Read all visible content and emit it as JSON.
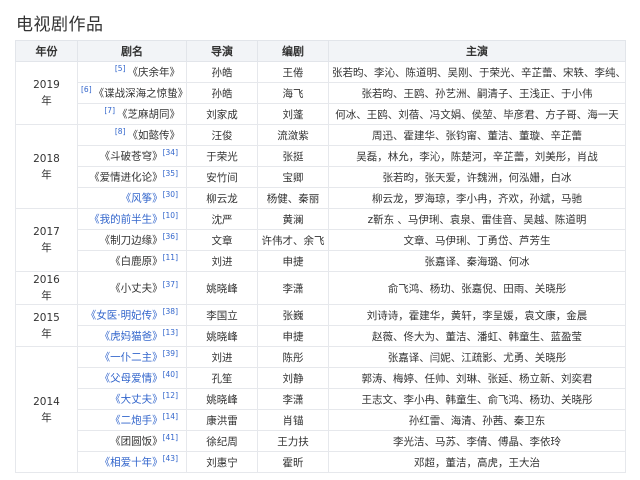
{
  "page": {
    "heading": "电视剧作品"
  },
  "table": {
    "headers": {
      "year": "年份",
      "drama": "剧名",
      "director": "导演",
      "writer": "编剧",
      "cast": "主演"
    },
    "groups": [
      {
        "year_top": "2019",
        "year_bottom": "年",
        "rows": [
          {
            "ref": "[5]",
            "title": "《庆余年》",
            "link": false,
            "director": "孙皓",
            "writer": "王倦",
            "cast": "张若昀、李沁、陈道明、吴刚、于荣光、辛芷蕾、宋轶、李纯、肖战"
          },
          {
            "ref": "[6]",
            "title": "《谍战深海之惊蛰》",
            "link": false,
            "director": "孙皓",
            "writer": "海飞",
            "cast": "张若昀、王鸥、孙艺洲、嗣清子、王浅正、于小伟"
          },
          {
            "ref": "[7]",
            "title": "《芝麻胡同》",
            "link": false,
            "director": "刘家成",
            "writer": "刘蓬",
            "cast": "何冰、王鸥、刘蓓、冯文娟、侯堃、毕彦君、方子哥、海一天"
          }
        ]
      },
      {
        "year_top": "2018",
        "year_bottom": "年",
        "rows": [
          {
            "ref": "[8]",
            "title": "《如懿传》",
            "link": false,
            "director": "汪俊",
            "writer": "流潋紫",
            "cast": "周迅、霍建华、张钧甯、董洁、董璇、辛芷蕾"
          },
          {
            "ref": "",
            "title": "《斗破苍穹》",
            "sup": "[34]",
            "link": false,
            "director": "于荣光",
            "writer": "张挺",
            "cast": "吴磊，林允，李沁，陈楚河，辛芷蕾，刘美彤，肖战"
          },
          {
            "ref": "",
            "title": "《爱情进化论》",
            "sup": "[35]",
            "link": false,
            "director": "安竹间",
            "writer": "宝卿",
            "cast": "张若昀，张天爱，许魏洲，何泓姗，白冰"
          },
          {
            "ref": "",
            "title": "《风筝》",
            "sup": "[30]",
            "link": true,
            "director": "柳云龙",
            "writer": "杨健、秦丽",
            "cast": "柳云龙，罗海琼，李小冉，齐欢，孙斌，马驰"
          }
        ]
      },
      {
        "year_top": "2017",
        "year_bottom": "年",
        "rows": [
          {
            "ref": "",
            "title": "《我的前半生》",
            "sup": "[10]",
            "link": true,
            "director": "沈严",
            "writer": "黄澜",
            "cast": "z靳东 、马伊琍、袁泉、雷佳音、吴越、陈道明"
          },
          {
            "ref": "",
            "title": "《制刀边缘》",
            "sup": "[36]",
            "link": false,
            "director": "文章",
            "writer": "许伟才、余飞",
            "cast": "文章、马伊琍、丁勇岱、芦芳生"
          },
          {
            "ref": "",
            "title": "《白鹿原》",
            "sup": "[11]",
            "link": false,
            "director": "刘进",
            "writer": "申捷",
            "cast": "张嘉译、秦海璐、何冰"
          }
        ]
      },
      {
        "year_top": "2016",
        "year_bottom": "年",
        "rows": [
          {
            "ref": "",
            "title": "《小丈夫》",
            "sup": "[37]",
            "link": false,
            "director": "姚晓峰",
            "writer": "李潇",
            "cast": "俞飞鸿、杨玏、张嘉倪、田雨、关晓彤"
          }
        ]
      },
      {
        "year_top": "2015",
        "year_bottom": "年",
        "rows": [
          {
            "ref": "",
            "title": "《女医·明妃传》",
            "sup": "[38]",
            "link": true,
            "director": "李国立",
            "writer": "张巍",
            "cast": "刘诗诗，霍建华，黄轩，李呈媛，袁文康，金晨"
          },
          {
            "ref": "",
            "title": "《虎妈猫爸》",
            "sup": "[13]",
            "link": true,
            "director": "姚晓峰",
            "writer": "申捷",
            "cast": "赵薇、佟大为、董洁、潘虹、韩童生、蓝盈莹"
          }
        ]
      },
      {
        "year_top": "2014",
        "year_bottom": "年",
        "rows": [
          {
            "ref": "",
            "title": "《一仆二主》",
            "sup": "[39]",
            "link": true,
            "director": "刘进",
            "writer": "陈彤",
            "cast": "张嘉译、闫妮、江疏影、尤勇、关晓彤"
          },
          {
            "ref": "",
            "title": "《父母爱情》",
            "sup": "[40]",
            "link": true,
            "director": "孔笙",
            "writer": "刘静",
            "cast": "郭涛、梅婷、任帅、刘琳、张延、杨立新、刘奕君"
          },
          {
            "ref": "",
            "title": "《大丈夫》",
            "sup": "[12]",
            "link": true,
            "director": "姚晓峰",
            "writer": "李潇",
            "cast": "王志文、李小冉、韩童生、俞飞鸿、杨玏、关晓彤"
          },
          {
            "ref": "",
            "title": "《二炮手》",
            "sup": "[14]",
            "link": true,
            "director": "康洪雷",
            "writer": "肖锚",
            "cast": "孙红雷、海清、孙茜、秦卫东"
          },
          {
            "ref": "",
            "title": "《团圆饭》",
            "sup": "[41]",
            "link": false,
            "director": "徐纪周",
            "writer": "王力扶",
            "cast": "李光洁、马苏、李倩、傅晶、李依玲"
          },
          {
            "ref": "",
            "title": "《相爱十年》",
            "sup": "[43]",
            "link": true,
            "director": "刘惠宁",
            "writer": "霍昕",
            "cast": "邓超，董洁，高虎，王大治"
          }
        ]
      }
    ]
  }
}
